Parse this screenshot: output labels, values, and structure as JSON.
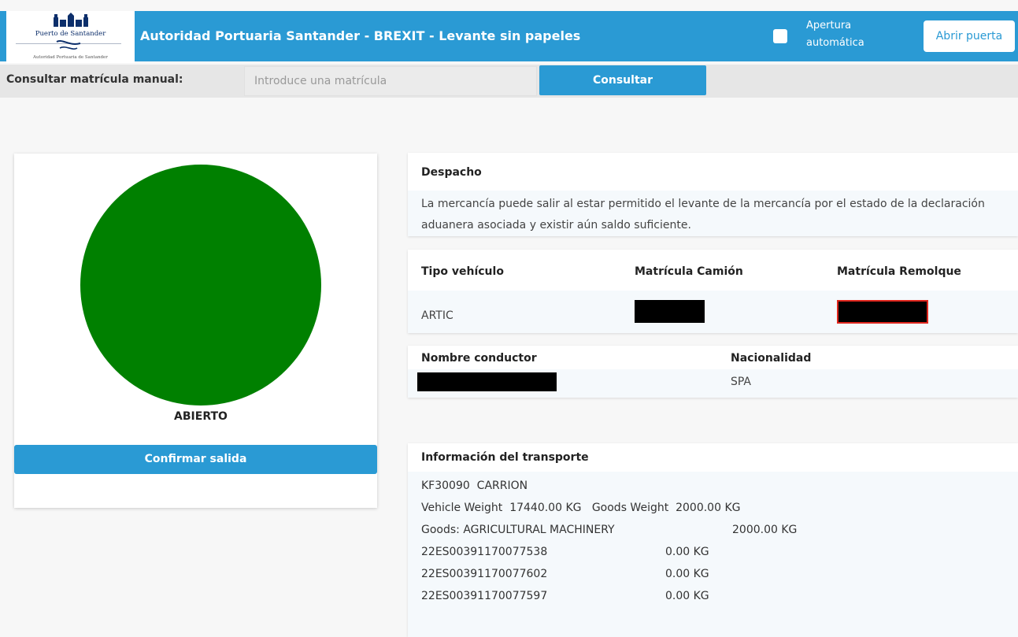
{
  "header": {
    "logo_name": "Puerto de Santander",
    "logo_sub": "Autoridad Portuaria de Santander",
    "title": "Autoridad Portuaria Santander - BREXIT - Levante sin papeles",
    "auto_open_label": "Apertura automática",
    "auto_open_checked": false,
    "open_door_label": "Abrir puerta"
  },
  "search": {
    "label": "Consultar matrícula manual:",
    "placeholder": "Introduce una matrícula",
    "value": "",
    "button_label": "Consultar"
  },
  "status": {
    "text": "ABIERTO",
    "color": "#008000",
    "confirm_label": "Confirmar salida"
  },
  "despacho": {
    "title": "Despacho",
    "message": "La mercancía puede salir al estar permitido el levante de la mercancía por el estado de la declaración aduanera asociada y existir aún saldo suficiente."
  },
  "vehiculo": {
    "headers": [
      "Tipo vehículo",
      "Matrícula Camión",
      "Matrícula Remolque"
    ],
    "tipo": "ARTIC"
  },
  "conductor": {
    "headers": [
      "Nombre conductor",
      "Nacionalidad"
    ],
    "nacionalidad": "SPA"
  },
  "transporte": {
    "title": "Información del transporte",
    "lines": [
      {
        "a": "KF30090  CARRION",
        "b": ""
      },
      {
        "a": "Vehicle Weight  17440.00 KG   Goods Weight  2000.00 KG",
        "b": ""
      },
      {
        "a": "Goods: AGRICULTURAL MACHINERY",
        "b": "2000.00 KG"
      },
      {
        "a": "22ES00391170077538",
        "b": "0.00 KG"
      },
      {
        "a": "22ES00391170077602",
        "b": "0.00 KG"
      },
      {
        "a": "22ES00391170077597",
        "b": "0.00 KG"
      }
    ]
  }
}
